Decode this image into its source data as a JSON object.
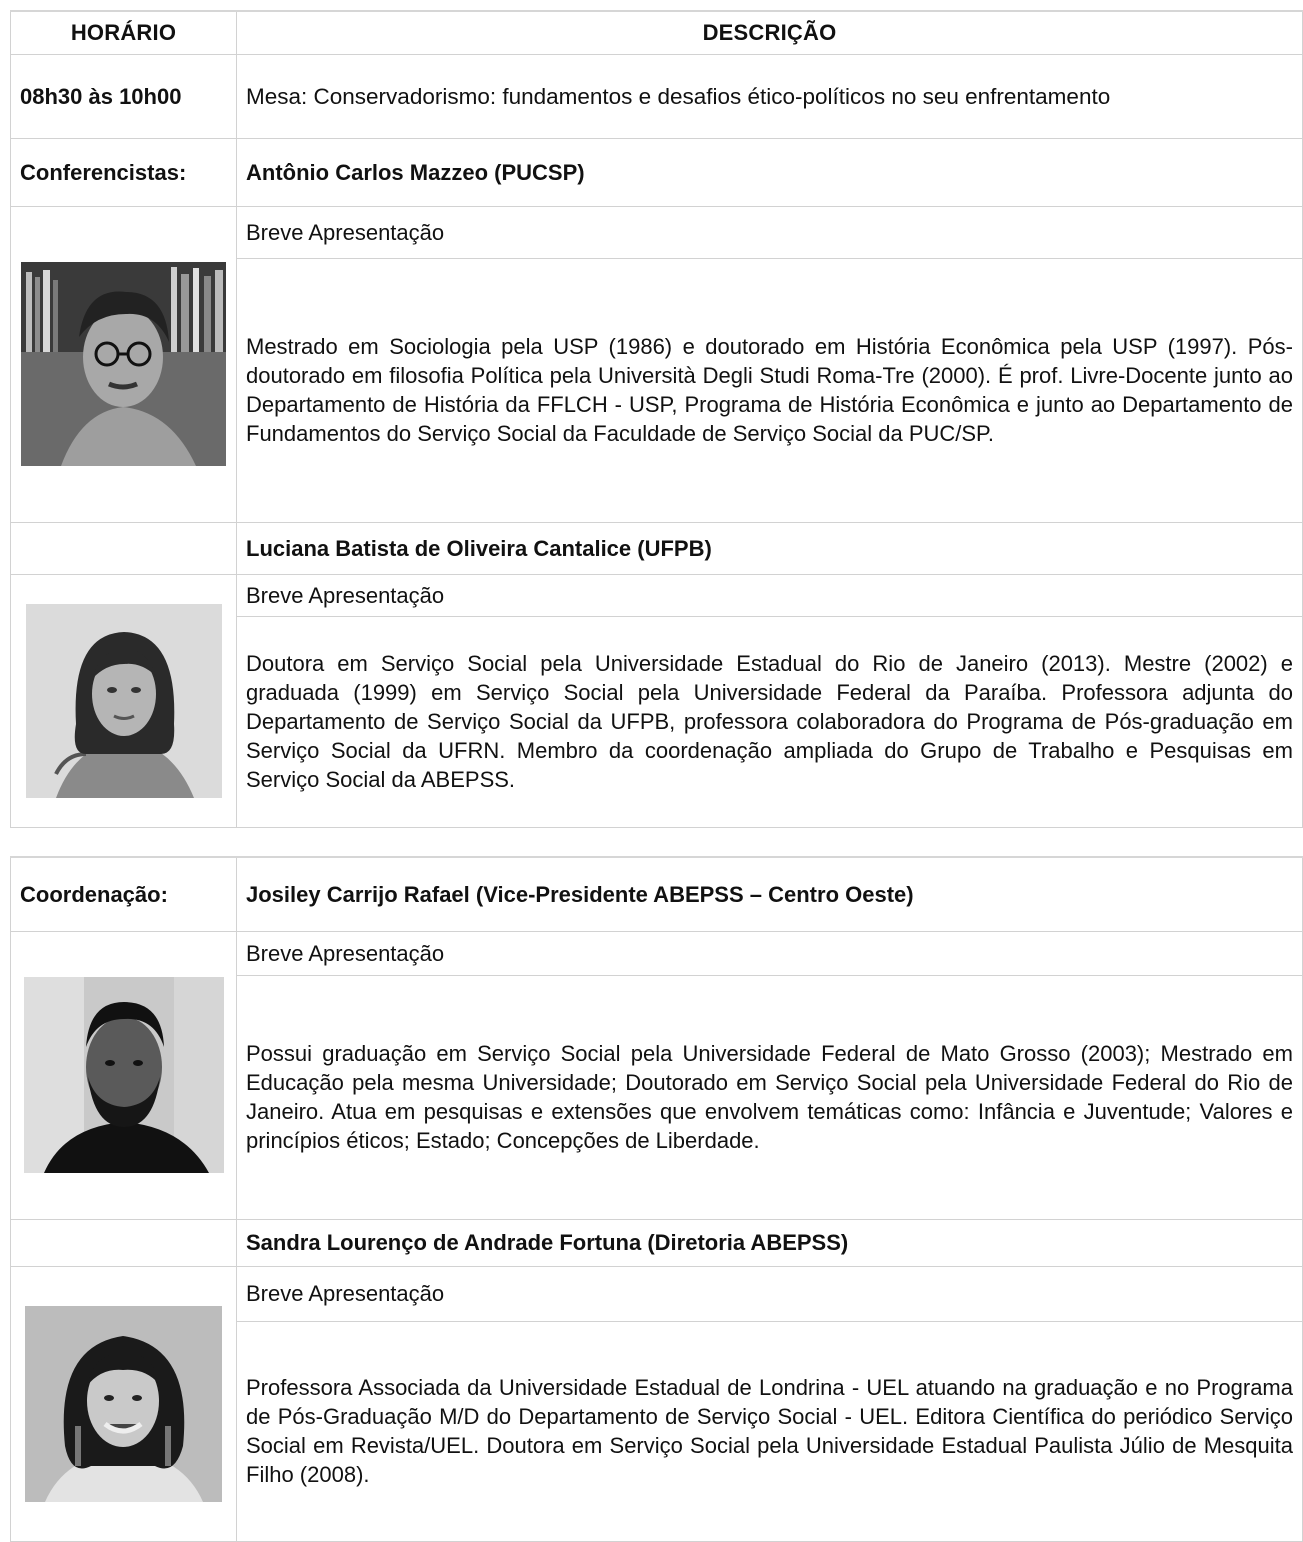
{
  "header": {
    "col1": "HORÁRIO",
    "col2": "DESCRIÇÃO"
  },
  "session": {
    "time": "08h30 às 10h00",
    "title": "Mesa: Conservadorismo: fundamentos e desafios ético-políticos no seu enfrentamento"
  },
  "labels": {
    "speakers": "Conferencistas:",
    "coordination": "Coordenação:"
  },
  "speakers": [
    {
      "name": "Antônio Carlos Mazzeo (PUCSP)",
      "section": "Breve Apresentação",
      "bio": "Mestrado em Sociologia pela USP (1986) e doutorado em História Econômica pela USP (1997). Pós-doutorado em filosofia Política pela Università Degli Studi Roma-Tre (2000). É prof. Livre-Docente junto ao Departamento de História da FFLCH - USP, Programa de História Econômica e junto ao Departamento de Fundamentos do Serviço Social da Faculdade de Serviço Social da PUC/SP."
    },
    {
      "name": "Luciana Batista de Oliveira Cantalice (UFPB)",
      "section": "Breve Apresentação",
      "bio": "Doutora em Serviço Social pela Universidade Estadual do Rio de Janeiro (2013). Mestre (2002) e graduada (1999) em Serviço Social pela Universidade Federal da Paraíba. Professora adjunta do Departamento de Serviço Social da UFPB, professora colaboradora do Programa de Pós-graduação em Serviço Social da UFRN. Membro da coordenação ampliada do Grupo de Trabalho e Pesquisas em Serviço Social da ABEPSS."
    }
  ],
  "coordinators": [
    {
      "name": "Josiley Carrijo Rafael (Vice-Presidente ABEPSS – Centro Oeste)",
      "section": "Breve Apresentação",
      "bio": "Possui graduação em Serviço Social pela Universidade Federal de Mato Grosso (2003); Mestrado em Educação pela mesma Universidade; Doutorado em Serviço Social pela Universidade Federal do Rio de Janeiro. Atua em pesquisas e extensões que envolvem temáticas como: Infância e Juventude; Valores e princípios éticos; Estado; Concepções de Liberdade."
    },
    {
      "name": "Sandra Lourenço de Andrade Fortuna (Diretoria ABEPSS)",
      "section": "Breve Apresentação",
      "bio": "Professora Associada da Universidade Estadual de Londrina - UEL atuando na graduação e no Programa de Pós-Graduação M/D do Departamento de Serviço Social - UEL. Editora Científica do periódico Serviço Social em Revista/UEL. Doutora em Serviço Social pela Universidade Estadual Paulista Júlio de Mesquita Filho (2008)."
    }
  ]
}
